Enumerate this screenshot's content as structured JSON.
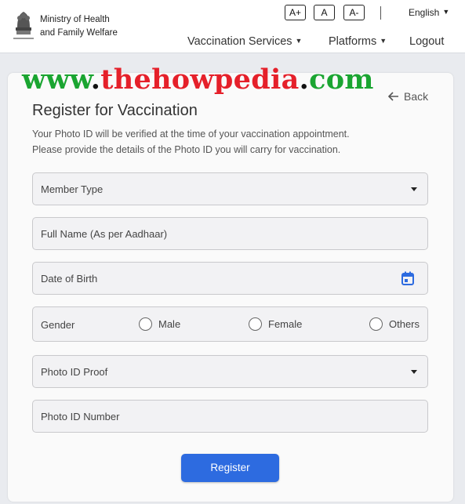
{
  "header": {
    "ministry_line1": "Ministry of Health",
    "ministry_line2": "and Family Welfare",
    "font_increase": "A+",
    "font_normal": "A",
    "font_decrease": "A-",
    "language": "English",
    "nav": {
      "vaccination_services": "Vaccination Services",
      "platforms": "Platforms",
      "logout": "Logout"
    }
  },
  "watermark": {
    "part1": "www",
    "dot1": ".",
    "part2": "thehowpedia",
    "dot2": ".",
    "part3": "com"
  },
  "form": {
    "title": "Register for Vaccination",
    "back_label": "Back",
    "subtitle_line1": "Your Photo ID will be verified at the time of your vaccination appointment.",
    "subtitle_line2": "Please provide the details of the Photo ID you will carry for vaccination.",
    "member_type": "Member Type",
    "full_name": "Full Name (As per Aadhaar)",
    "dob": "Date of Birth",
    "gender_label": "Gender",
    "gender_options": [
      "Male",
      "Female",
      "Others"
    ],
    "photo_id_proof": "Photo ID Proof",
    "photo_id_number": "Photo ID Number",
    "register_label": "Register"
  },
  "colors": {
    "primary_button": "#2d6be0",
    "watermark_green": "#1aa531",
    "watermark_red": "#e5202a"
  }
}
